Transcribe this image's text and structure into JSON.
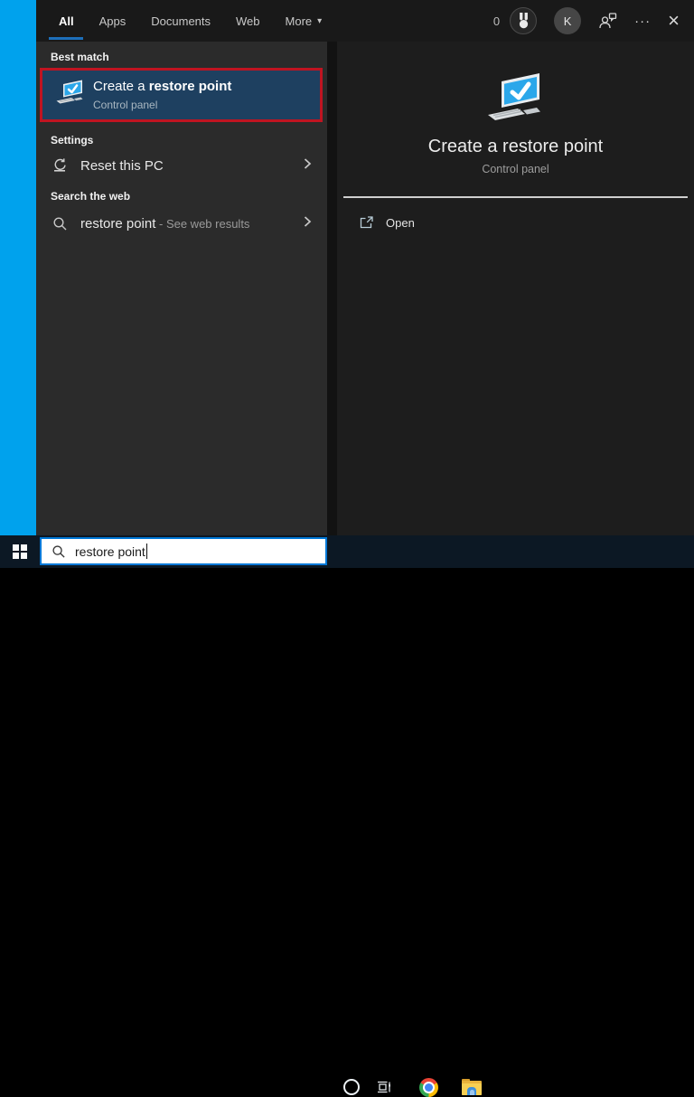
{
  "topbar": {
    "tabs": [
      {
        "label": "All",
        "selected": true
      },
      {
        "label": "Apps",
        "selected": false
      },
      {
        "label": "Documents",
        "selected": false
      },
      {
        "label": "Web",
        "selected": false
      },
      {
        "label": "More",
        "selected": false
      }
    ],
    "rewards_count": "0",
    "avatar_initial": "K"
  },
  "icons": {
    "more_caret": "▾",
    "ellipsis": "···",
    "close": "×"
  },
  "results": {
    "best_match_header": "Best match",
    "best_match": {
      "title_regular": "Create a ",
      "title_bold": "restore point",
      "subtitle": "Control panel"
    },
    "settings_header": "Settings",
    "settings_item_label": "Reset this PC",
    "web_header": "Search the web",
    "web_item_query": "restore point",
    "web_item_suffix": " - See web results"
  },
  "preview": {
    "title": "Create a restore point",
    "subtitle": "Control panel",
    "open_label": "Open"
  },
  "taskbar": {
    "search_value": "restore point"
  },
  "colors": {
    "accent_blue": "#0078d7",
    "desktop_blue": "#00a2ed",
    "selection_bg": "#1e4060",
    "annotation_red": "#c01421",
    "tab_underline": "#1d6fba"
  }
}
